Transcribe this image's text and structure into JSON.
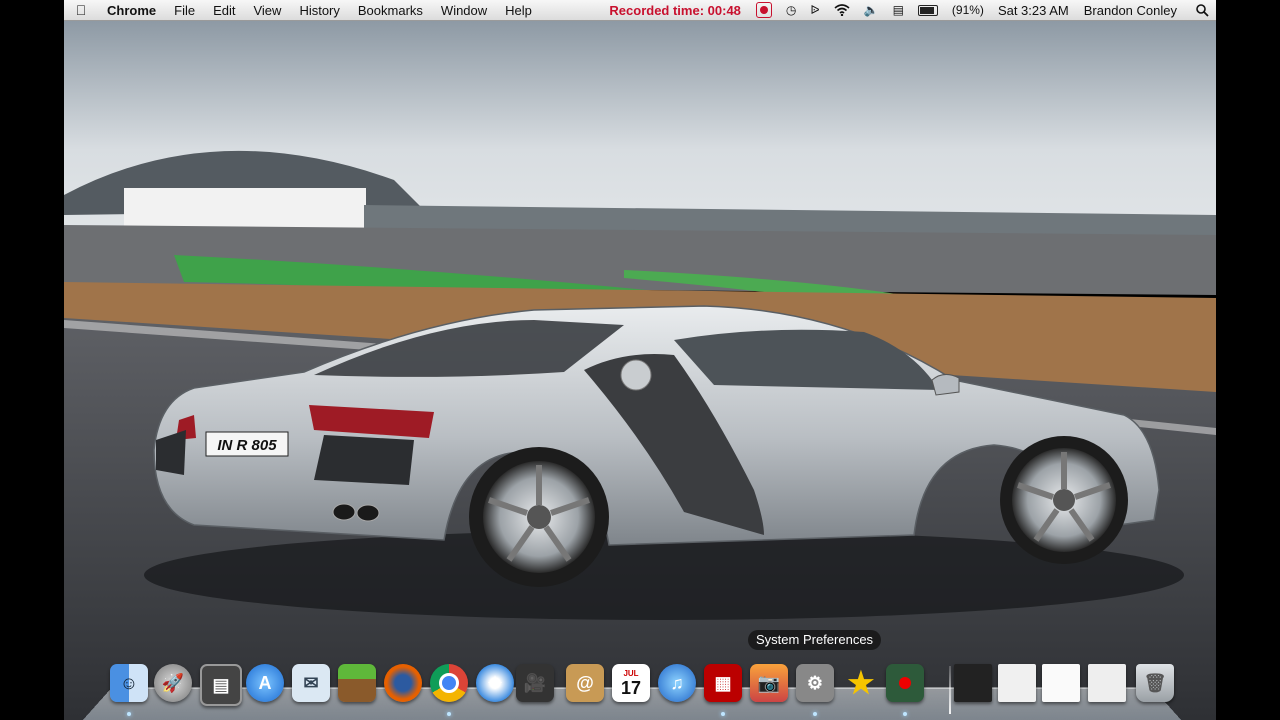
{
  "menubar": {
    "app_name": "Chrome",
    "menus": [
      "File",
      "Edit",
      "View",
      "History",
      "Bookmarks",
      "Window",
      "Help"
    ],
    "recorded_label": "Recorded time: 00:48",
    "battery_percent": "(91%)",
    "clock": "Sat 3:23 AM",
    "user": "Brandon Conley"
  },
  "dock": {
    "tooltip": "System Preferences",
    "calendar_day": "17",
    "calendar_month": "JUL",
    "items": [
      "finder-icon",
      "launchpad-icon",
      "utility-icon",
      "app-store-icon",
      "mail-icon",
      "minecraft-icon",
      "firefox-icon",
      "chrome-icon",
      "safari-icon",
      "facetime-icon",
      "contacts-icon",
      "calendar-icon",
      "itunes-icon",
      "photo-booth-icon",
      "iphoto-icon",
      "system-preferences-icon",
      "imovie-icon",
      "video-recorder-icon",
      "window-thumbnail-icon",
      "trash-icon"
    ]
  },
  "wallpaper": {
    "plate_text": "IN R 805"
  }
}
